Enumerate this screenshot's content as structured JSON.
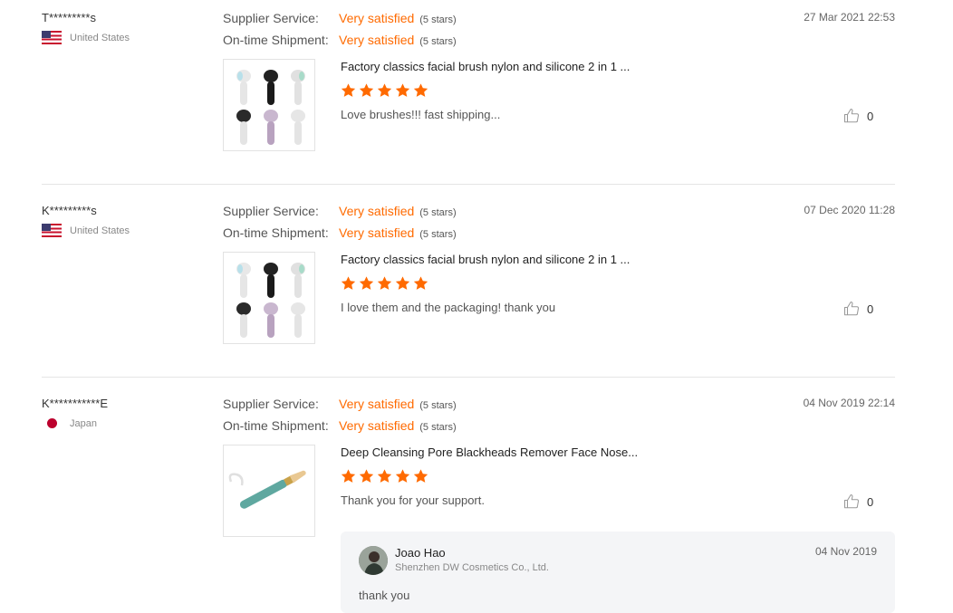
{
  "reviews": [
    {
      "buyer": "T*********s",
      "country": "United States",
      "country_flag": "us-flag-icon",
      "supplier_label": "Supplier Service:",
      "supplier_value": "Very satisfied",
      "supplier_stars": "(5 stars)",
      "shipment_label": "On-time Shipment:",
      "shipment_value": "Very satisfied",
      "shipment_stars": "(5 stars)",
      "date": "27 Mar 2021 22:53",
      "product": "Factory classics facial brush nylon and silicone 2 in 1 ...",
      "rating": 5,
      "comment": "Love brushes!!! fast shipping...",
      "likes": "0"
    },
    {
      "buyer": "K*********s",
      "country": "United States",
      "country_flag": "us-flag-icon",
      "supplier_label": "Supplier Service:",
      "supplier_value": "Very satisfied",
      "supplier_stars": "(5 stars)",
      "shipment_label": "On-time Shipment:",
      "shipment_value": "Very satisfied",
      "shipment_stars": "(5 stars)",
      "date": "07 Dec 2020 11:28",
      "product": "Factory classics facial brush nylon and silicone 2 in 1 ...",
      "rating": 5,
      "comment": "I love them and the packaging! thank you",
      "likes": "0"
    },
    {
      "buyer": "K***********E",
      "country": "Japan",
      "country_flag": "jp-flag-icon",
      "supplier_label": "Supplier Service:",
      "supplier_value": "Very satisfied",
      "supplier_stars": "(5 stars)",
      "shipment_label": "On-time Shipment:",
      "shipment_value": "Very satisfied",
      "shipment_stars": "(5 stars)",
      "date": "04 Nov 2019 22:14",
      "product": "Deep Cleansing Pore Blackheads Remover Face Nose...",
      "rating": 5,
      "comment": "Thank you for your support.",
      "likes": "0"
    }
  ],
  "reply": {
    "name": "Joao Hao",
    "company": "Shenzhen DW Cosmetics Co., Ltd.",
    "date": "04 Nov 2019",
    "text": "thank you"
  },
  "colors": {
    "accent": "#ff6a00",
    "star": "#ff6a00",
    "separator": "#e5e5e5"
  }
}
